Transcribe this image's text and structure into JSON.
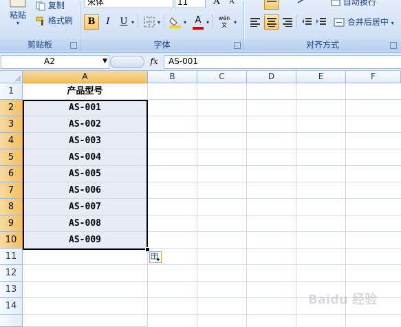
{
  "ribbon": {
    "clipboard": {
      "paste_label": "粘贴",
      "copy_label": "复制",
      "format_painter_label": "格式刷",
      "group_label": "剪贴板"
    },
    "font": {
      "font_name": "宋体",
      "font_size": "11",
      "grow_label": "A",
      "shrink_label": "A",
      "bold_label": "B",
      "italic_label": "I",
      "underline_label": "U",
      "font_color_label": "A",
      "phonetic_label": "wén 文",
      "group_label": "字体",
      "font_color": "#e00000",
      "fill_color": "#ffd700"
    },
    "alignment": {
      "wrap_label": "自动换行",
      "merge_label": "合并后居中",
      "group_label": "对齐方式"
    }
  },
  "formula_bar": {
    "name_box": "A2",
    "fx_label": "fx",
    "formula": "AS-001"
  },
  "grid": {
    "columns": [
      "A",
      "B",
      "C",
      "D",
      "E",
      "F"
    ],
    "selected_column": "A",
    "rows": [
      "1",
      "2",
      "3",
      "4",
      "5",
      "6",
      "7",
      "8",
      "9",
      "10",
      "11",
      "12",
      "13",
      "14"
    ],
    "selected_rows": [
      "2",
      "3",
      "4",
      "5",
      "6",
      "7",
      "8",
      "9",
      "10"
    ],
    "column_a": [
      "产品型号",
      "AS-001",
      "AS-002",
      "AS-003",
      "AS-004",
      "AS-005",
      "AS-006",
      "AS-007",
      "AS-008",
      "AS-009"
    ]
  },
  "watermark": "Baidu 经验"
}
